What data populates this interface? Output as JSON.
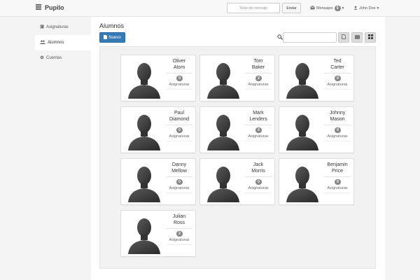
{
  "navbar": {
    "brand": "Pupilo",
    "message_placeholder": "Texto del mensaje",
    "send_label": "Enviar",
    "messages_label": "Mensajes",
    "messages_count": "0",
    "user_label": "John Doe"
  },
  "sidebar": {
    "items": [
      {
        "label": "Asignaturas",
        "icon": "book-icon",
        "active": false
      },
      {
        "label": "Alumnos",
        "icon": "users-icon",
        "active": true
      },
      {
        "label": "Cuentas",
        "icon": "gear-icon",
        "active": false
      }
    ]
  },
  "main": {
    "title": "Alumnos",
    "new_label": "Nuevo",
    "search_placeholder": "",
    "view_buttons": [
      "file-icon",
      "list-icon",
      "grid-icon"
    ],
    "accent_color": "#337ab7"
  },
  "students": [
    {
      "first": "Oliver",
      "last": "Atom",
      "count": "0",
      "subjects_label": "Asignaturas"
    },
    {
      "first": "Tom",
      "last": "Baker",
      "count": "2",
      "subjects_label": "Asignaturas"
    },
    {
      "first": "Ted",
      "last": "Carter",
      "count": "0",
      "subjects_label": "Asignaturas"
    },
    {
      "first": "Paul",
      "last": "Diamond",
      "count": "0",
      "subjects_label": "Asignaturas"
    },
    {
      "first": "Mark",
      "last": "Lenders",
      "count": "0",
      "subjects_label": "Asignaturas"
    },
    {
      "first": "Johnny",
      "last": "Mason",
      "count": "0",
      "subjects_label": "Asignaturas"
    },
    {
      "first": "Danny",
      "last": "Mellow",
      "count": "0",
      "subjects_label": "Asignaturas"
    },
    {
      "first": "Jack",
      "last": "Morris",
      "count": "0",
      "subjects_label": "Asignaturas"
    },
    {
      "first": "Benjamin",
      "last": "Price",
      "count": "0",
      "subjects_label": "Asignaturas"
    },
    {
      "first": "Julian",
      "last": "Ross",
      "count": "2",
      "subjects_label": "Asignaturas"
    }
  ]
}
